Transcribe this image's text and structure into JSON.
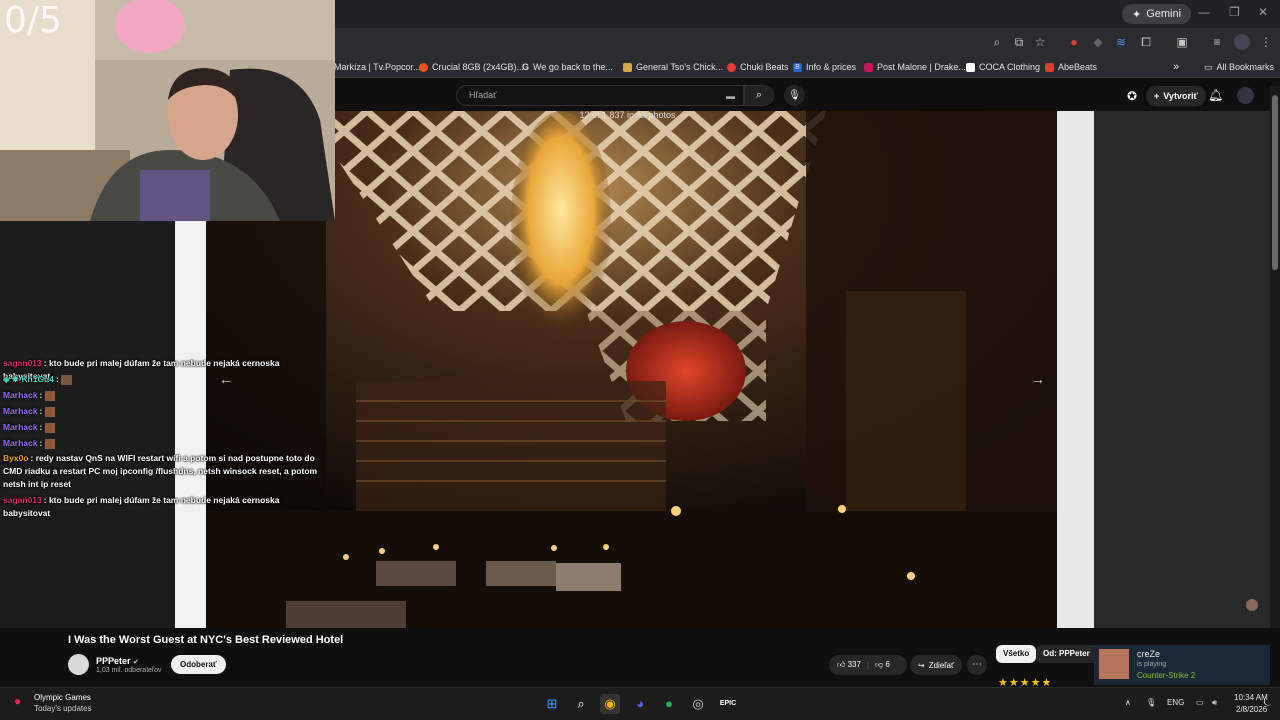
{
  "browser": {
    "gemini_label": "Gemini",
    "bookmarks": [
      {
        "label": "Markíza | Tv.Popcor...",
        "color": "#e53935"
      },
      {
        "label": "Crucial 8GB (2x4GB)...",
        "color": "#f4511e"
      },
      {
        "label": "We go back to the...",
        "color": "#9e9e9e"
      },
      {
        "label": "General Tso's Chick...",
        "color": "#d4a64a"
      },
      {
        "label": "Chuki Beats",
        "color": "#e53935"
      },
      {
        "label": "Info & prices",
        "color": "#1e66d0"
      },
      {
        "label": "Post Malone | Drake...",
        "color": "#c2185b"
      },
      {
        "label": "COCA Clothing",
        "color": "#cccccc"
      },
      {
        "label": "AbeBeats",
        "color": "#e53935"
      }
    ],
    "bookmarks_more": "»",
    "all_bookmarks": "All Bookmarks"
  },
  "youtube": {
    "search_placeholder": "Hľadať",
    "create_label": "Vytvoriť",
    "photo_counter": "12 of 1,837 in All photos",
    "video_title": "I Was the Worst Guest at NYC's Best Reviewed Hotel",
    "channel_name": "PPPeter",
    "channel_subs": "1,03 mil. odberateľov",
    "subscribe_label": "Odoberať",
    "likes": "337",
    "dislikes": "6",
    "share_label": "Zdieľať",
    "chip_all": "Všetko",
    "chip_from": "Od: PPPeter"
  },
  "webcam": {
    "counter": "0/5"
  },
  "chat": [
    {
      "user": "sagan013",
      "color": "#e0245e",
      "text": ": kto bude pri malej dúfam že tam nebude nejaká cernoska babysitovat"
    },
    {
      "user": "Kn1Gu4",
      "color": "#3fd6c3",
      "text": ":"
    },
    {
      "user": "Marhack",
      "color": "#9b6bff",
      "text": ":"
    },
    {
      "user": "Marhack",
      "color": "#9b6bff",
      "text": ":"
    },
    {
      "user": "Marhack",
      "color": "#9b6bff",
      "text": ":"
    },
    {
      "user": "Marhack",
      "color": "#9b6bff",
      "text": ":"
    },
    {
      "user": "Byx0o",
      "color": "#f0a020",
      "text": ": redy nastav QnS na WIFI restart wifi a potom si nad postupne toto do CMD riadku a restart PC moj ipconfig /flushdns, netsh winsock reset, a potom netsh int ip reset"
    },
    {
      "user": "sagan013",
      "color": "#e0245e",
      "text": ": kto bude pri malej dúfam že tam nebude nejaká cernoska babysitovat"
    }
  ],
  "steam": {
    "name": "creZe",
    "status": "is playing",
    "game": "Counter-Strike 2"
  },
  "taskbar": {
    "news_title": "Olympic Games",
    "news_sub": "Today's updates",
    "lang": "ENG",
    "time": "10:34 AM",
    "date": "2/8/2026"
  },
  "colors": {
    "youtube_bg": "#0f0f0f",
    "accent_red": "#ff0000"
  }
}
